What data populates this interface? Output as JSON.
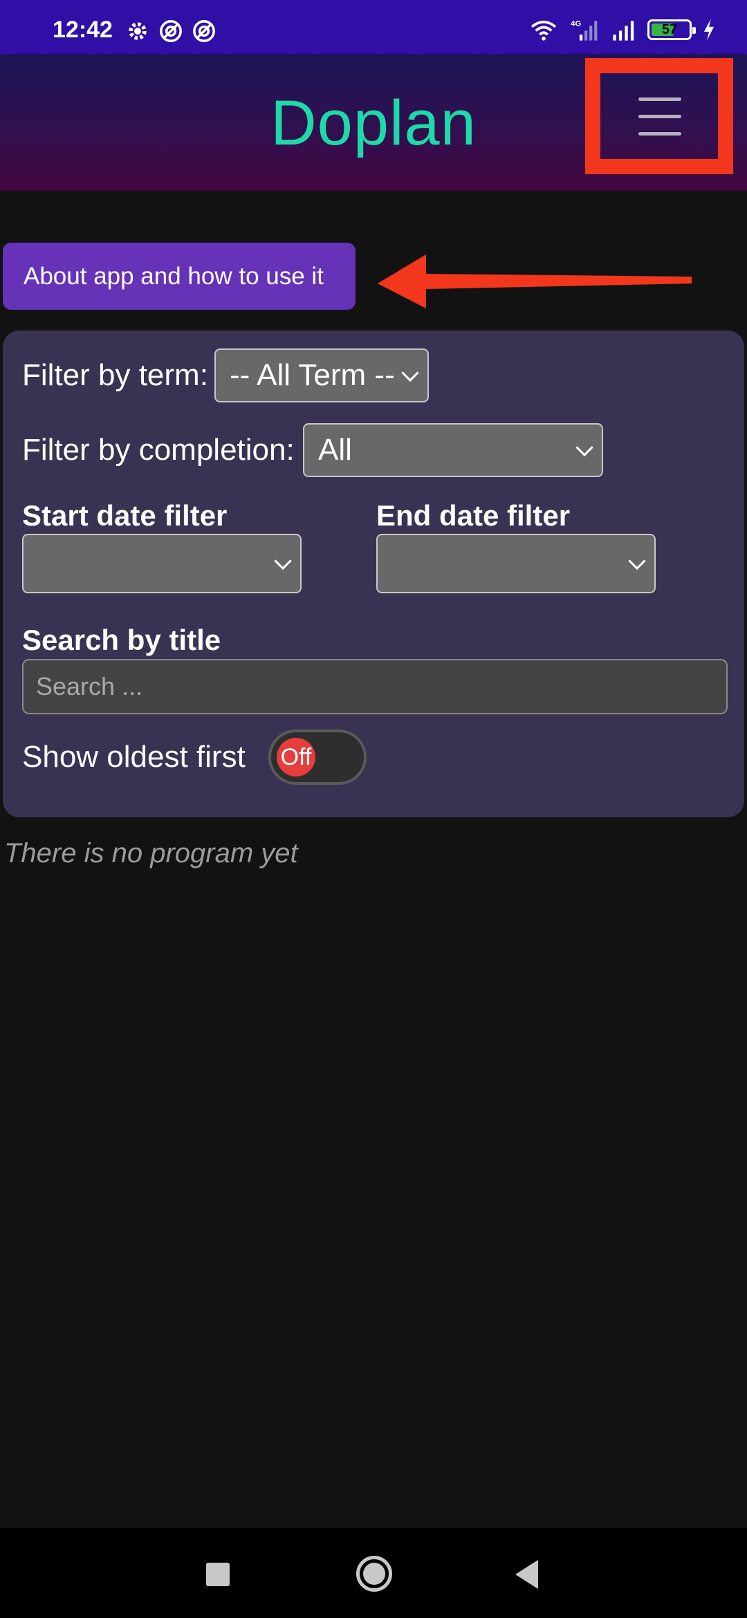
{
  "status_bar": {
    "time": "12:42",
    "battery": "57",
    "network": "4G"
  },
  "header": {
    "title": "Doplan",
    "menu_icon": "hamburger-menu-icon"
  },
  "about_button": {
    "label": "About app and how to use it"
  },
  "filters": {
    "term_label": "Filter by term:",
    "term_value": "-- All Term --",
    "completion_label": "Filter by completion:",
    "completion_value": "All",
    "start_date_label": "Start date filter",
    "start_date_value": "",
    "end_date_label": "End date filter",
    "end_date_value": "",
    "search_label": "Search by title",
    "search_placeholder": "Search ...",
    "oldest_label": "Show oldest first",
    "oldest_toggle": "Off"
  },
  "empty_message": "There is no program yet",
  "colors": {
    "status_bar": "#2f0fa6",
    "title": "#1ed9a8",
    "about_button": "#6633b8",
    "panel": "#3a3252",
    "annotation": "#f2371d",
    "toggle_knob": "#e63d3d"
  }
}
